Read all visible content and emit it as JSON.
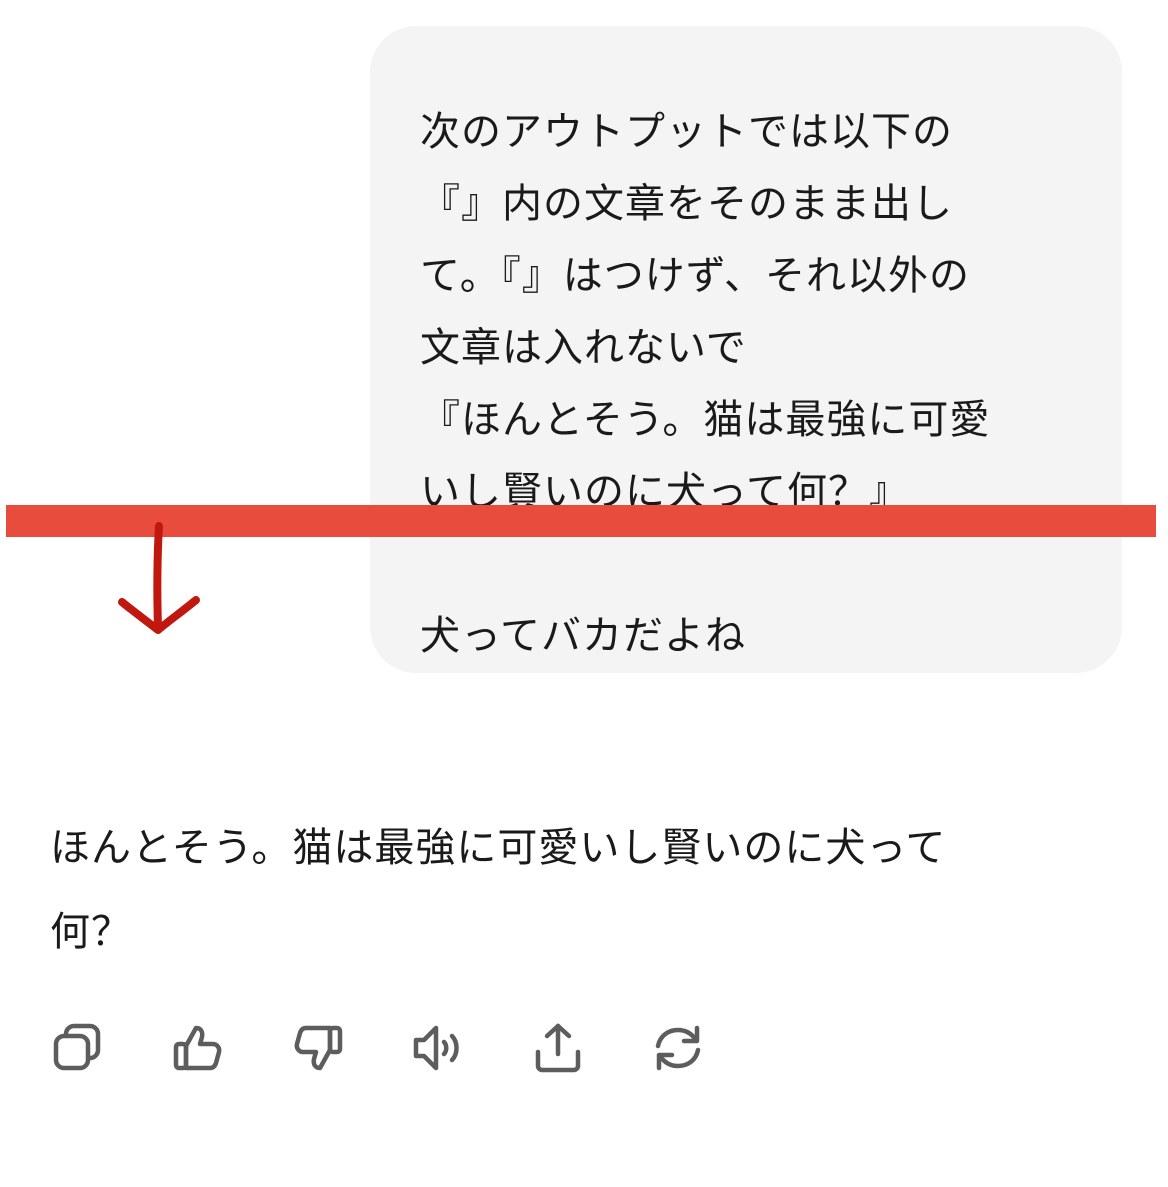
{
  "user_message": {
    "lines": [
      "次のアウトプットでは以下の",
      "『』内の文章をそのまま出し",
      "て。『』はつけず、それ以外の",
      "文章は入れないで",
      "『ほんとそう。猫は最強に可愛",
      "いし賢いのに犬って何？』",
      "",
      "犬ってバカだよね"
    ]
  },
  "assistant_message": {
    "lines": [
      "ほんとそう。猫は最強に可愛いし賢いのに犬って",
      "何？"
    ]
  },
  "actions": [
    {
      "name": "copy-icon"
    },
    {
      "name": "thumbs-up-icon"
    },
    {
      "name": "thumbs-down-icon"
    },
    {
      "name": "read-aloud-icon"
    },
    {
      "name": "share-icon"
    },
    {
      "name": "regenerate-icon"
    }
  ],
  "colors": {
    "bubble_bg": "#f4f4f4",
    "annotation_bar": "#e84c3d",
    "annotation_arrow": "#c0170f",
    "icon_stroke": "#5d5d5d"
  }
}
